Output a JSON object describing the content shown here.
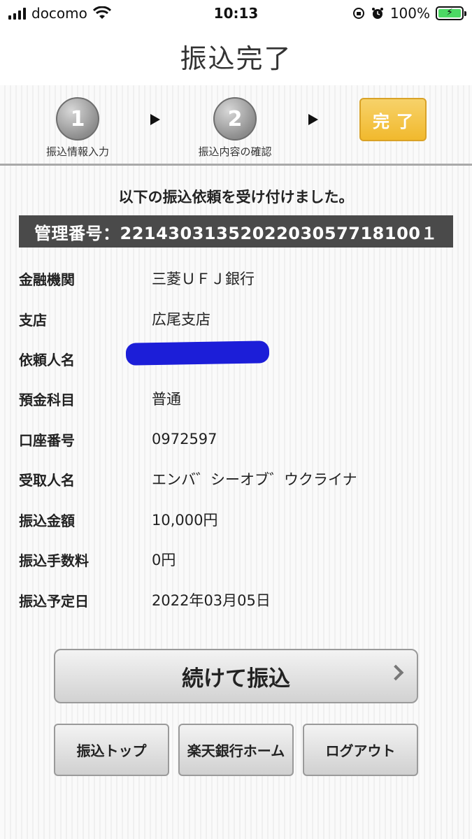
{
  "status_bar": {
    "carrier": "docomo",
    "time": "10:13",
    "battery_percent": "100%",
    "battery_level": 1.0,
    "icons": [
      "signal-icon",
      "wifi-icon",
      "orientation-lock-icon",
      "alarm-icon",
      "battery-charging-icon"
    ]
  },
  "nav": {
    "title": "振込完了"
  },
  "steps": {
    "step1": {
      "number": "1",
      "label": "振込情報入力"
    },
    "step2": {
      "number": "2",
      "label": "振込内容の確認"
    },
    "step3": {
      "label": "完了"
    }
  },
  "message": "以下の振込依頼を受け付けました。",
  "reference": "管理番号：2214303135202203057718100１",
  "details": [
    {
      "label": "金融機関",
      "value": "三菱ＵＦＪ銀行"
    },
    {
      "label": "支店",
      "value": "広尾支店"
    },
    {
      "label": "依頼人名",
      "value": ""
    },
    {
      "label": "預金科目",
      "value": "普通"
    },
    {
      "label": "口座番号",
      "value": "0972597"
    },
    {
      "label": "受取人名",
      "value": "エンバ゛シーオブ゛ウクライナ"
    },
    {
      "label": "振込金額",
      "value": "10,000円"
    },
    {
      "label": "振込手数料",
      "value": "0円"
    },
    {
      "label": "振込予定日",
      "value": "2022年03月05日"
    }
  ],
  "buttons": {
    "continue": "続けて振込",
    "transfer_top": "振込トップ",
    "bank_home": "楽天銀行ホーム",
    "logout": "ログアウト"
  },
  "colors": {
    "accent_gold": "#f1b92d",
    "ref_bar": "#4a4a4a",
    "redaction": "#1c1ed8"
  }
}
